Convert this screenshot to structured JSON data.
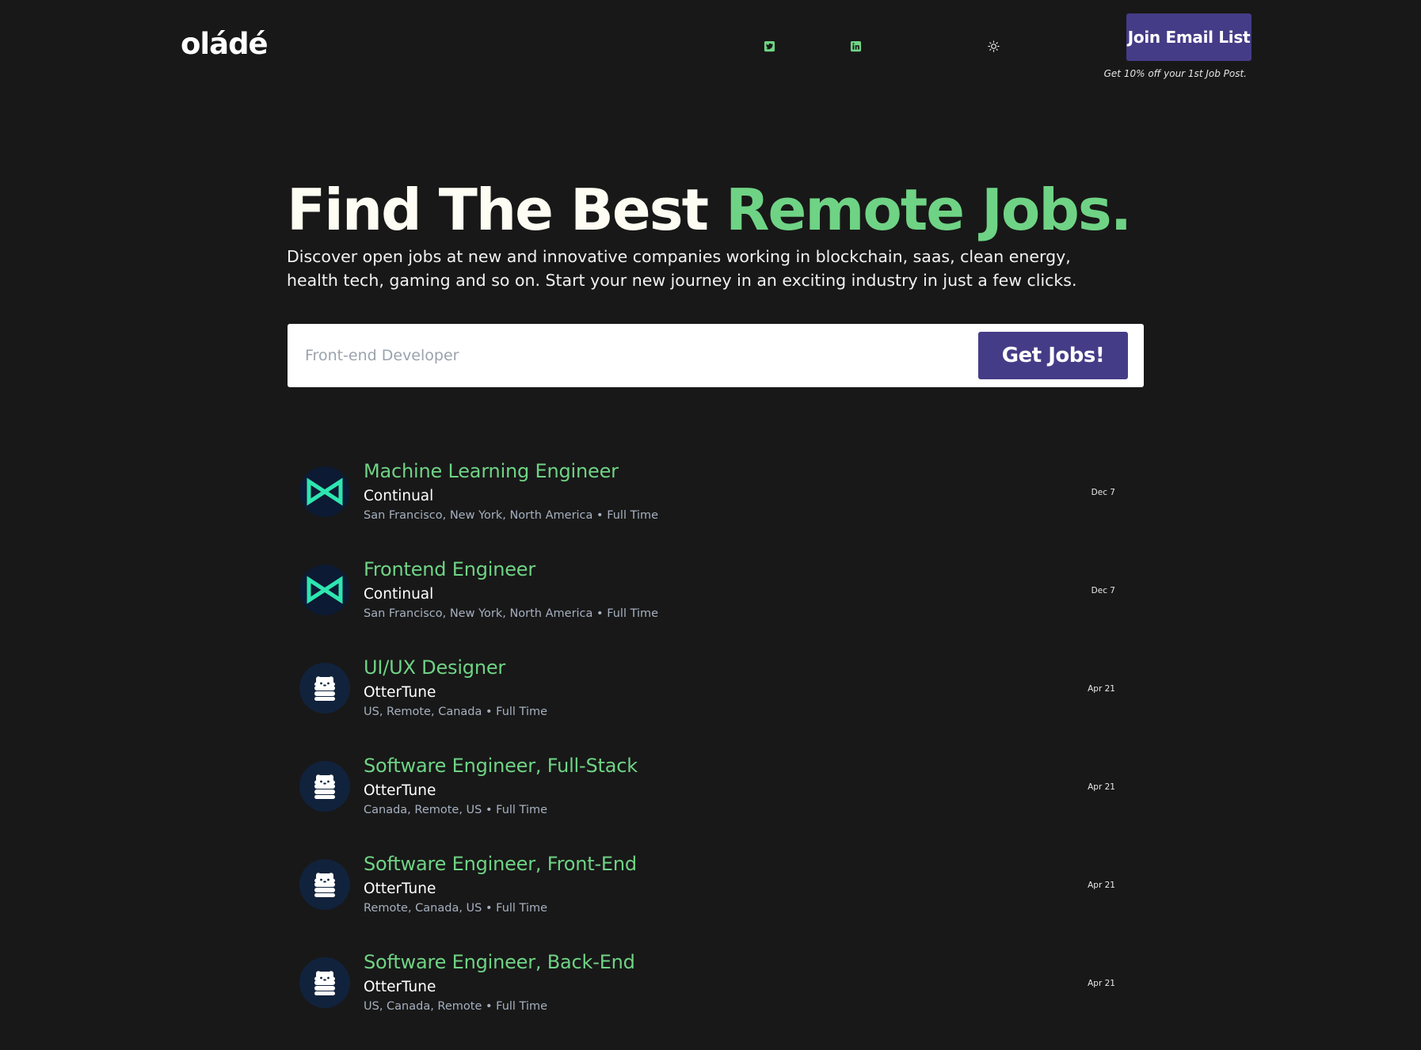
{
  "header": {
    "logo": "oládé",
    "social": [
      {
        "icon": "twitter-icon",
        "color": "#6fd385"
      },
      {
        "icon": "linkedin-icon",
        "color": "#6fd385"
      }
    ],
    "theme_icon": "sun-icon",
    "join_label": "Join Email List",
    "promo_text": "Get 10% off your 1st Job Post."
  },
  "hero": {
    "title_white": "Find The Best",
    "title_green": "Remote Jobs.",
    "description": "Discover open jobs at new and innovative companies working in blockchain, saas, clean energy, health tech, gaming and so on. Start your new journey in an exciting industry in just a few clicks."
  },
  "search": {
    "placeholder": "Front-end Developer",
    "value": "",
    "button_label": "Get Jobs!"
  },
  "colors": {
    "background": "#181818",
    "accent_green": "#6fd385",
    "button_purple": "#453c87"
  },
  "jobs": [
    {
      "title": "Machine Learning Engineer",
      "company": "Continual",
      "meta": "San Francisco, New York, North America • Full Time",
      "date": "Dec 7",
      "logo": "continual-logo-icon"
    },
    {
      "title": "Frontend Engineer",
      "company": "Continual",
      "meta": "San Francisco, New York, North America • Full Time",
      "date": "Dec 7",
      "logo": "continual-logo-icon"
    },
    {
      "title": "UI/UX Designer",
      "company": "OtterTune",
      "meta": "US, Remote, Canada • Full Time",
      "date": "Apr 21",
      "logo": "ottertune-logo-icon"
    },
    {
      "title": "Software Engineer, Full-Stack",
      "company": "OtterTune",
      "meta": "Canada, Remote, US • Full Time",
      "date": "Apr 21",
      "logo": "ottertune-logo-icon"
    },
    {
      "title": "Software Engineer, Front-End",
      "company": "OtterTune",
      "meta": "Remote, Canada, US • Full Time",
      "date": "Apr 21",
      "logo": "ottertune-logo-icon"
    },
    {
      "title": "Software Engineer, Back-End",
      "company": "OtterTune",
      "meta": "US, Canada, Remote • Full Time",
      "date": "Apr 21",
      "logo": "ottertune-logo-icon"
    }
  ]
}
